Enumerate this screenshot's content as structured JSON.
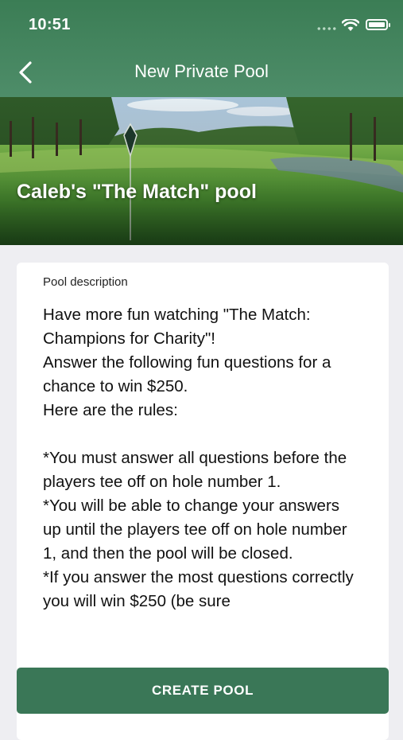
{
  "status_bar": {
    "time": "10:51"
  },
  "nav": {
    "title": "New Private Pool"
  },
  "hero": {
    "title": "Caleb's \"The Match\" pool"
  },
  "card": {
    "label": "Pool description",
    "description": "Have more fun watching \"The Match: Champions for Charity\"!\nAnswer the following fun questions for a chance to win $250.\nHere are the rules:\n\n*You must answer all questions before the players tee off on hole number 1.\n*You will be able to change your answers up until the players tee off on hole number 1, and then the pool will be closed.\n*If you answer the most questions correctly you will win $250 (be sure"
  },
  "cta": {
    "label": "CREATE POOL"
  },
  "colors": {
    "header": "#3b7d55",
    "button": "#3a7757",
    "background": "#eeeef2"
  },
  "icons": [
    "back-chevron-icon",
    "wifi-icon",
    "battery-icon",
    "signal-dots-icon"
  ]
}
